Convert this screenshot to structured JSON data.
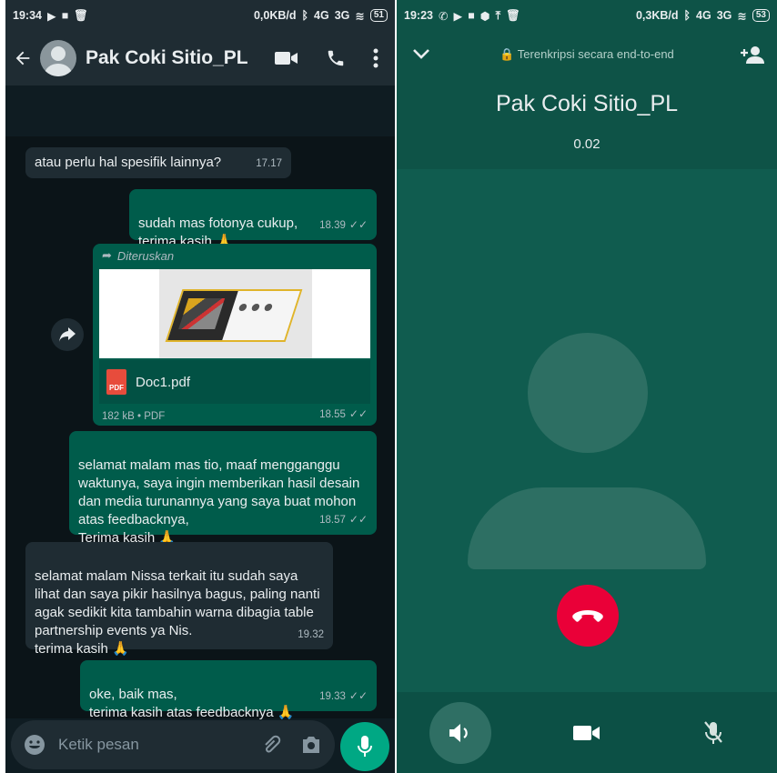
{
  "left": {
    "status": {
      "time": "19:34",
      "net": "0,0KB/d",
      "signal": "4G",
      "signal2": "3G",
      "battery": "51"
    },
    "header": {
      "contact": "Pak Coki Sitio_PL"
    },
    "messages": [
      {
        "text": "atau perlu hal spesifik lainnya?",
        "time": "17.17"
      },
      {
        "text": "sudah mas fotonya cukup,\nterima kasih 🙏",
        "time": "18.39"
      },
      {
        "text": "selamat malam mas tio, maaf mengganggu waktunya, saya ingin memberikan hasil desain dan media turunannya  yang saya buat mohon atas feedbacknya,\nTerima kasih 🙏",
        "time": "18.57"
      },
      {
        "text": "selamat malam Nissa terkait itu sudah saya lihat dan saya pikir hasilnya bagus, paling nanti agak sedikit kita tambahin warna dibagia table partnership events ya Nis.\nterima kasih 🙏",
        "time": "19.32"
      },
      {
        "text": "oke, baik mas,\nterima kasih atas feedbacknya 🙏",
        "time": "19.33"
      }
    ],
    "forwarded": {
      "label": "Diteruskan",
      "filename": "Doc1.pdf",
      "pdf_badge": "PDF",
      "meta": "182 kB • PDF",
      "time": "18.55"
    },
    "input": {
      "placeholder": "Ketik pesan"
    }
  },
  "right": {
    "status": {
      "time": "19:23",
      "net": "0,3KB/d",
      "signal": "4G",
      "signal2": "3G",
      "battery": "53"
    },
    "encryption": "Terenkripsi secara end-to-end",
    "contact": "Pak Coki Sitio_PL",
    "duration": "0.02"
  },
  "colors": {
    "accent": "#00a884",
    "end_call": "#ea0038",
    "outgoing": "#005c4b"
  }
}
